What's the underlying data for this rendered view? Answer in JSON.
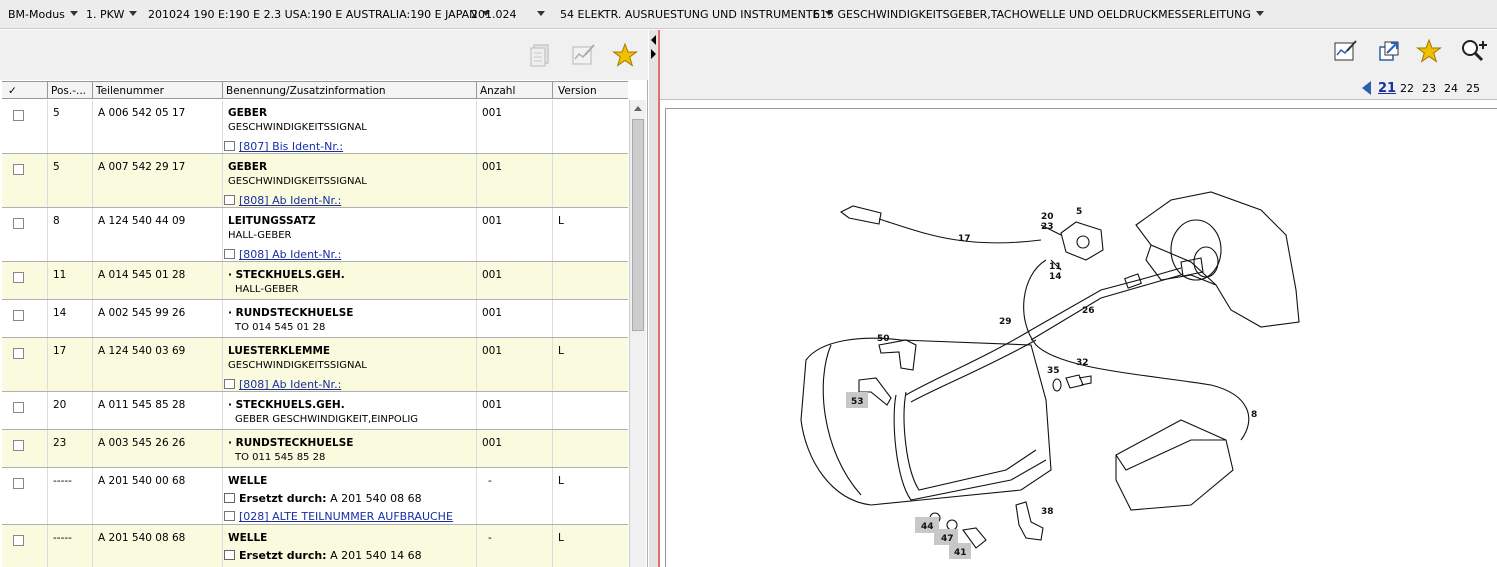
{
  "breadcrumb": [
    {
      "label": "BM-Modus"
    },
    {
      "label": "1. PKW"
    },
    {
      "label": "201024 190 E:190 E 2.3 USA:190 E AUSTRALIA:190 E JAPAN"
    },
    {
      "label": "201.024"
    },
    {
      "label": "54 ELEKTR. AUSRUESTUNG UND INSTRUMENTE"
    },
    {
      "label": "615 GESCHWINDIGKEITSGEBER,TACHOWELLE UND OELDRUCKMESSERLEITUNG"
    }
  ],
  "table": {
    "headers": {
      "check": "✓",
      "pos": "Pos.-...",
      "part": "Teilenummer",
      "name": "Benennung/Zusatzinformation",
      "qty": "Anzahl",
      "version": "Version"
    },
    "rows": [
      {
        "pos": "5",
        "part": "A 006 542 05 17",
        "name": "GEBER",
        "info": "GESCHWINDIGKEITSSIGNAL",
        "note": "[807] Bis Ident-Nr.:",
        "qty": "001",
        "version": ""
      },
      {
        "pos": "5",
        "part": "A 007 542 29 17",
        "name": "GEBER",
        "info": "GESCHWINDIGKEITSSIGNAL",
        "note": "[808] Ab Ident-Nr.:",
        "qty": "001",
        "version": ""
      },
      {
        "pos": "8",
        "part": "A 124 540 44 09",
        "name": "LEITUNGSSATZ",
        "info": "HALL-GEBER",
        "note": "[808] Ab Ident-Nr.:",
        "qty": "001",
        "version": "L"
      },
      {
        "pos": "11",
        "part": "A 014 545 01 28",
        "name": "STECKHUELS.GEH.",
        "info": "HALL-GEBER",
        "note": "",
        "qty": "001",
        "version": ""
      },
      {
        "pos": "14",
        "part": "A 002 545 99 26",
        "name": "RUNDSTECKHUELSE",
        "info": "TO 014 545 01 28",
        "note": "",
        "qty": "001",
        "version": ""
      },
      {
        "pos": "17",
        "part": "A 124 540 03 69",
        "name": "LUESTERKLEMME",
        "info": "GESCHWINDIGKEITSSIGNAL",
        "note": "[808] Ab Ident-Nr.:",
        "qty": "001",
        "version": "L"
      },
      {
        "pos": "20",
        "part": "A 011 545 85 28",
        "name": "STECKHUELS.GEH.",
        "info": "GEBER GESCHWINDIGKEIT,EINPOLIG",
        "note": "",
        "qty": "001",
        "version": ""
      },
      {
        "pos": "23",
        "part": "A 003 545 26 26",
        "name": "RUNDSTECKHUELSE",
        "info": "TO 011 545 85 28",
        "note": "",
        "qty": "001",
        "version": ""
      },
      {
        "pos": "-----",
        "part": "A 201 540 00 68",
        "name": "WELLE",
        "replaced_label": "Ersetzt durch:",
        "replaced_part": "A 201 540 08 68",
        "note": "[028] ALTE TEILNUMMER AUFBRAUCHE",
        "qty": "-",
        "version": "L"
      },
      {
        "pos": "-----",
        "part": "A 201 540 08 68",
        "name": "WELLE",
        "replaced_label": "Ersetzt durch:",
        "replaced_part": "A 201 540 14 68",
        "note": "",
        "qty": "-",
        "version": "L"
      }
    ]
  },
  "pager": {
    "current": "21",
    "pages": [
      "22",
      "23",
      "24",
      "25"
    ]
  },
  "diagram": {
    "labels": [
      "17",
      "20",
      "23",
      "5",
      "11",
      "14",
      "26",
      "29",
      "50",
      "53",
      "35",
      "32",
      "8",
      "44",
      "47",
      "41",
      "38"
    ]
  },
  "icons": {
    "left_toolbar": [
      "add-to-list-icon",
      "edit-notes-icon",
      "favorite-star-icon"
    ],
    "right_toolbar": [
      "edit-notes-icon",
      "external-window-icon",
      "favorite-star-icon",
      "zoom-in-icon"
    ]
  },
  "colors": {
    "alt_row": "#fafadf",
    "link": "#1a2fa0",
    "star": "#f0c000",
    "active_border": "#e07070"
  }
}
